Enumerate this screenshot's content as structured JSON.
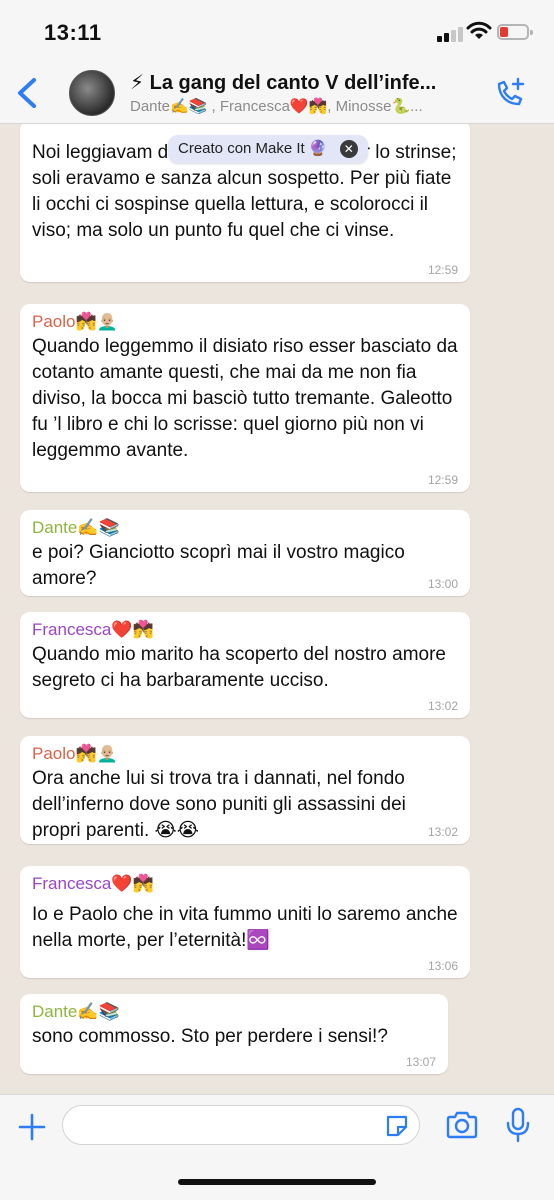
{
  "status_bar": {
    "time": "13:11"
  },
  "header": {
    "title": "⚡ La gang del canto V dell’infe...",
    "members": "Dante✍️📚 , Francesca❤️💏, Minosse🐍..."
  },
  "tooltip": {
    "label": "Creato con Make It 🔮",
    "close": "✕"
  },
  "messages": [
    {
      "sender": "",
      "text": "Noi leggiavam                          di Lancialotto come amor lo strinse; soli eravamo e sanza alcun sospetto. Per più fiate li occhi ci sospinse quella lettura, e scolorocci il viso; ma solo un punto fu quel che ci vinse.",
      "time": "12:59"
    },
    {
      "sender": "Paolo💏👨🏼‍🦲",
      "sender_color": "#d9634a",
      "text": "Quando leggemmo il disiato riso esser basciato da cotanto amante questi, che mai da me non fia diviso, la bocca mi basciò tutto tremante. Galeotto fu ’l libro e chi lo scrisse: quel giorno più non vi leggemmo avante.",
      "time": "12:59"
    },
    {
      "sender": "Dante✍️📚",
      "sender_color": "#8fb53e",
      "text": "e poi? Gianciotto scoprì mai il vostro magico amore?",
      "time": "13:00"
    },
    {
      "sender": "Francesca❤️💏",
      "sender_color": "#9b46c2",
      "text": "Quando mio marito ha scoperto del nostro amore segreto ci ha barbaramente ucciso.",
      "time": "13:02"
    },
    {
      "sender": "Paolo💏👨🏼‍🦲",
      "sender_color": "#d9634a",
      "text": "Ora anche lui si trova tra i dannati, nel fondo dell’inferno dove sono puniti gli assassini dei propri parenti. 😭😭",
      "time": "13:02"
    },
    {
      "sender": "Francesca❤️💏",
      "sender_color": "#9b46c2",
      "text": "Io e Paolo che in vita fummo uniti lo saremo anche nella morte, per l’eternità!♾️",
      "time": "13:06"
    },
    {
      "sender": "Dante✍️📚",
      "sender_color": "#8fb53e",
      "text": "sono commosso. Sto per perdere i sensi!?",
      "time": "13:07"
    }
  ],
  "input": {
    "placeholder": ""
  },
  "colors": {
    "accent": "#2f7df6",
    "chat_bg": "#ece5dd",
    "bubble": "#ffffff"
  }
}
